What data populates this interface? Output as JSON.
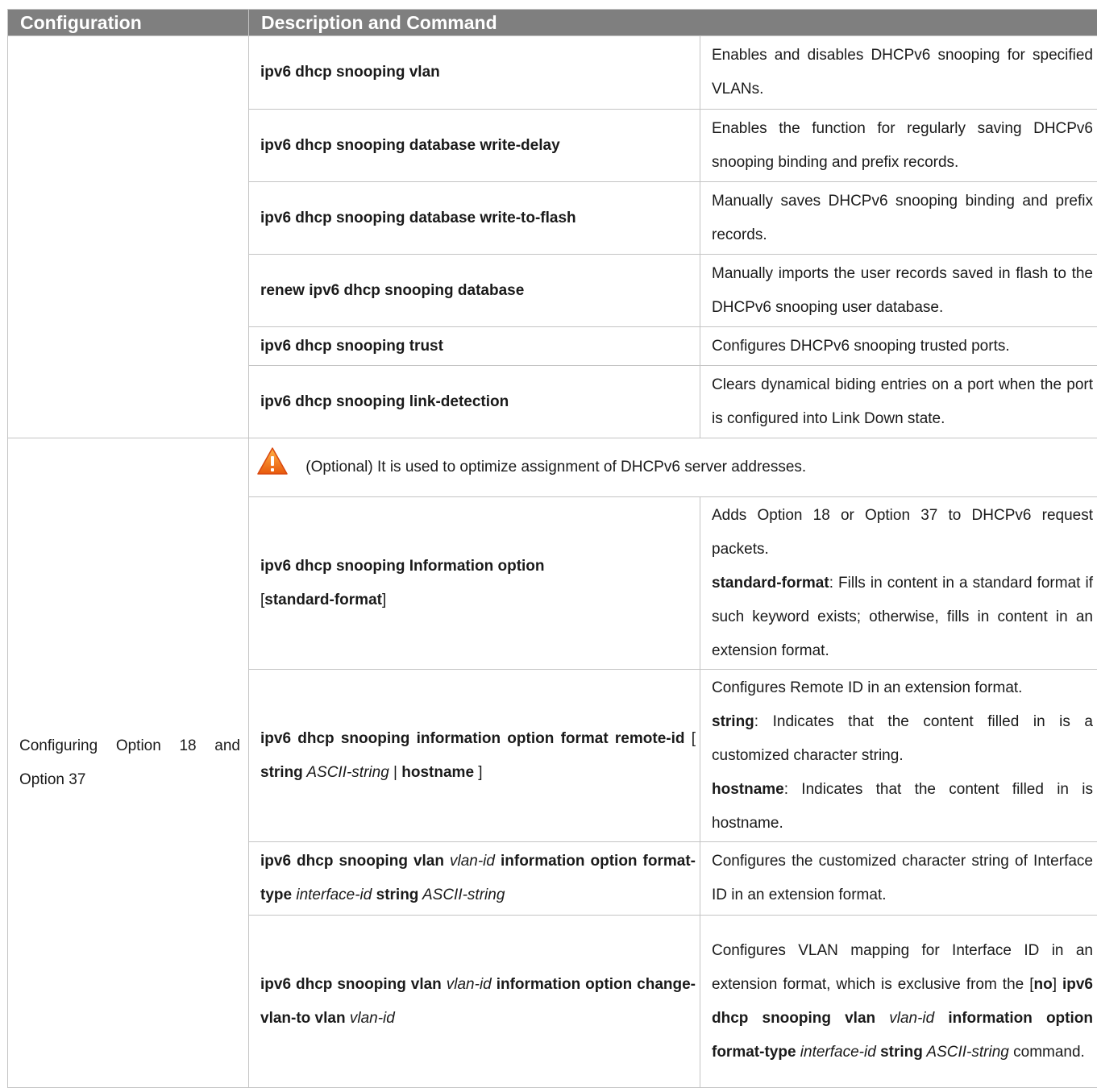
{
  "header": {
    "col1": "Configuration",
    "col2": "Description and Command"
  },
  "section1": {
    "rows": [
      {
        "cmd": "ipv6 dhcp snooping vlan",
        "desc": "Enables and disables DHCPv6 snooping for specified VLANs."
      },
      {
        "cmd": "ipv6 dhcp snooping database write-delay",
        "desc": "Enables the function for regularly saving DHCPv6 snooping binding and prefix records."
      },
      {
        "cmd": "ipv6 dhcp snooping database write-to-flash",
        "desc": "Manually saves DHCPv6 snooping binding and prefix records."
      },
      {
        "cmd": "renew ipv6 dhcp snooping database",
        "desc": "Manually imports the user records saved in flash to the DHCPv6 snooping user database."
      },
      {
        "cmd": "ipv6 dhcp snooping trust",
        "desc": "Configures DHCPv6 snooping trusted ports."
      },
      {
        "cmd": "ipv6 dhcp snooping link-detection",
        "desc": "Clears dynamical biding entries on a port when the port is configured into Link Down state."
      }
    ]
  },
  "section2": {
    "config": "Configuring Option 18 and Option 37",
    "note": "(Optional) It is used to optimize assignment of DHCPv6 server addresses.",
    "icon": "warning-icon",
    "row1": {
      "cmd_a": "ipv6 dhcp snooping Information option",
      "cmd_b_open": "[",
      "cmd_b_kw": "standard-format",
      "cmd_b_close": "]",
      "desc_line1": "Adds Option 18 or Option 37 to DHCPv6 request packets.",
      "desc_kw": "standard-format",
      "desc_rest": ": Fills in content in a standard format if such keyword exists; otherwise, fills in content in an extension format."
    },
    "row2": {
      "cmd_a": "ipv6 dhcp snooping information option format remote-id",
      "cmd_b": " [ ",
      "cmd_kw1": "string",
      "cmd_it1": " ASCII-string",
      "cmd_sep": " | ",
      "cmd_kw2": "hostname",
      "cmd_end": " ]",
      "desc_line1": "Configures Remote ID in an extension format.",
      "desc_kw1": "string",
      "desc_rest1": ": Indicates that the content filled in is a customized character string.",
      "desc_kw2": "hostname",
      "desc_rest2": ": Indicates that the content filled in is hostname."
    },
    "row3": {
      "cmd_a": "ipv6 dhcp snooping vlan",
      "cmd_it1": " vlan-id ",
      "cmd_b": "information option format-type",
      "cmd_it2": " interface-id ",
      "cmd_c": "string",
      "cmd_it3": " ASCII-string",
      "desc": "Configures the customized character string of Interface ID in an extension format."
    },
    "row4": {
      "cmd_a": "ipv6 dhcp snooping vlan",
      "cmd_it1": " vlan-id ",
      "cmd_b": "information option change-vlan-to vlan",
      "cmd_it2": " vlan-id",
      "desc_a": "Configures VLAN mapping for Interface ID in an extension format, which is exclusive from the [",
      "desc_no": "no",
      "desc_b": "] ",
      "desc_kw1": "ipv6 dhcp snooping vlan",
      "desc_it1": " vlan-id ",
      "desc_kw2": "information option format-type",
      "desc_it2": " interface-id ",
      "desc_kw3": "string",
      "desc_it3": " ASCII-string",
      "desc_end": " command."
    }
  }
}
